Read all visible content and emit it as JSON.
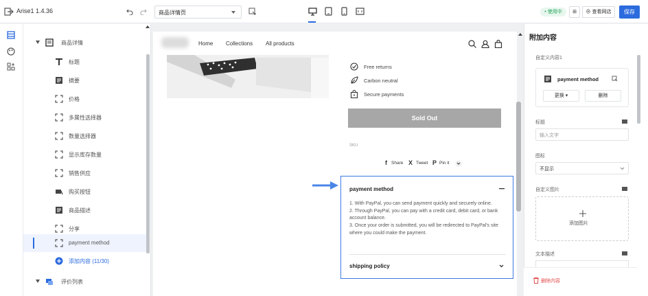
{
  "topbar": {
    "app_title": "Arise1 1.4.36",
    "template_select": "商品详情页",
    "status_badge": "• 使用中",
    "btn_template": "⊞",
    "btn_view_store": "⊕ 查看网店",
    "btn_save": "保存"
  },
  "tree": {
    "root": "商品详情",
    "items": [
      {
        "label": "标题",
        "icon": "text-icon"
      },
      {
        "label": "摘要",
        "icon": "doc-icon"
      },
      {
        "label": "价格",
        "icon": "frame-icon"
      },
      {
        "label": "多属性选择器",
        "icon": "frame-icon"
      },
      {
        "label": "数量选择器",
        "icon": "frame-icon"
      },
      {
        "label": "显示库存数量",
        "icon": "frame-icon"
      },
      {
        "label": "销售供应",
        "icon": "frame-icon"
      },
      {
        "label": "购买按钮",
        "icon": "buy-icon"
      },
      {
        "label": "商品描述",
        "icon": "doc-icon"
      },
      {
        "label": "分享",
        "icon": "frame-icon"
      },
      {
        "label": "payment method",
        "icon": "frame-icon"
      }
    ],
    "add_content": "添加内容 (11/30)",
    "reviews": "评价列表"
  },
  "store": {
    "nav": [
      "Home",
      "Collections",
      "All products"
    ],
    "features": [
      "Free returns",
      "Carbon neutral",
      "Secure payments"
    ],
    "sold_out": "Sold Out",
    "sku": "SKU",
    "share": [
      "Share",
      "Tweet",
      "Pin it"
    ],
    "accordion": {
      "title1": "payment method",
      "body": [
        "1. With PayPal, you can send payment quickly and securely online.",
        "2. Through PayPal, you can pay with a credit card, debit card, or bank account balance.",
        "3. Once your order is submitted, you will be redirected to PayPal's site where you could make the payment."
      ],
      "title2": "shipping policy"
    }
  },
  "panel": {
    "title": "附加内容",
    "custom_label": "自定义内容1",
    "card_name": "payment method",
    "replace": "更换",
    "delete": "删除",
    "heading_label": "标题",
    "heading_placeholder": "输入文字",
    "icon_label": "图标",
    "icon_select": "不显示",
    "image_label": "自定义图片",
    "add_image": "添加图片",
    "text_label": "文本描述",
    "remove_content": "删除内容"
  },
  "colors": {
    "accent": "#2b6bde",
    "highlight_border": "#3c78e3",
    "sold_out": "#a7a7a7"
  }
}
